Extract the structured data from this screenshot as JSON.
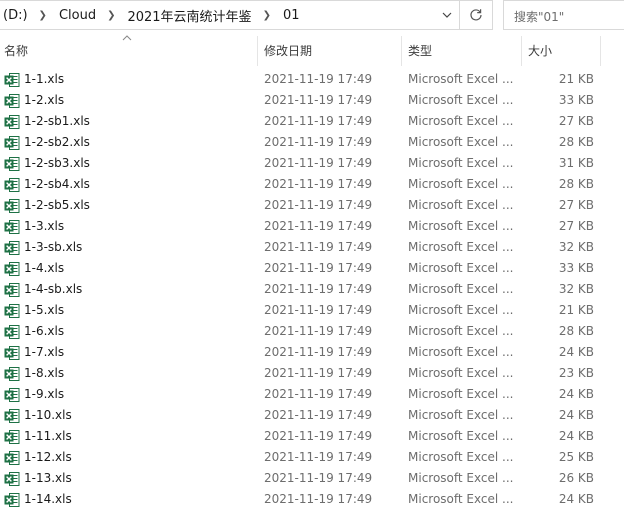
{
  "address_bar": {
    "segments": [
      "(D:)",
      "Cloud",
      "2021年云南统计年鉴",
      "01"
    ]
  },
  "search": {
    "placeholder": "搜索\"01\""
  },
  "columns": {
    "name": "名称",
    "modified": "修改日期",
    "type": "类型",
    "size": "大小"
  },
  "icons": {
    "file": "excel-file-icon",
    "refresh": "refresh-icon",
    "dropdown": "chevron-down-icon",
    "sort": "sort-ascending-icon"
  },
  "colors": {
    "excel_green": "#1e7145"
  },
  "files": [
    {
      "name": "1-1.xls",
      "modified": "2021-11-19 17:49",
      "type": "Microsoft Excel ...",
      "size": "21 KB"
    },
    {
      "name": "1-2.xls",
      "modified": "2021-11-19 17:49",
      "type": "Microsoft Excel ...",
      "size": "33 KB"
    },
    {
      "name": "1-2-sb1.xls",
      "modified": "2021-11-19 17:49",
      "type": "Microsoft Excel ...",
      "size": "27 KB"
    },
    {
      "name": "1-2-sb2.xls",
      "modified": "2021-11-19 17:49",
      "type": "Microsoft Excel ...",
      "size": "28 KB"
    },
    {
      "name": "1-2-sb3.xls",
      "modified": "2021-11-19 17:49",
      "type": "Microsoft Excel ...",
      "size": "31 KB"
    },
    {
      "name": "1-2-sb4.xls",
      "modified": "2021-11-19 17:49",
      "type": "Microsoft Excel ...",
      "size": "28 KB"
    },
    {
      "name": "1-2-sb5.xls",
      "modified": "2021-11-19 17:49",
      "type": "Microsoft Excel ...",
      "size": "27 KB"
    },
    {
      "name": "1-3.xls",
      "modified": "2021-11-19 17:49",
      "type": "Microsoft Excel ...",
      "size": "27 KB"
    },
    {
      "name": "1-3-sb.xls",
      "modified": "2021-11-19 17:49",
      "type": "Microsoft Excel ...",
      "size": "32 KB"
    },
    {
      "name": "1-4.xls",
      "modified": "2021-11-19 17:49",
      "type": "Microsoft Excel ...",
      "size": "33 KB"
    },
    {
      "name": "1-4-sb.xls",
      "modified": "2021-11-19 17:49",
      "type": "Microsoft Excel ...",
      "size": "32 KB"
    },
    {
      "name": "1-5.xls",
      "modified": "2021-11-19 17:49",
      "type": "Microsoft Excel ...",
      "size": "21 KB"
    },
    {
      "name": "1-6.xls",
      "modified": "2021-11-19 17:49",
      "type": "Microsoft Excel ...",
      "size": "28 KB"
    },
    {
      "name": "1-7.xls",
      "modified": "2021-11-19 17:49",
      "type": "Microsoft Excel ...",
      "size": "24 KB"
    },
    {
      "name": "1-8.xls",
      "modified": "2021-11-19 17:49",
      "type": "Microsoft Excel ...",
      "size": "23 KB"
    },
    {
      "name": "1-9.xls",
      "modified": "2021-11-19 17:49",
      "type": "Microsoft Excel ...",
      "size": "24 KB"
    },
    {
      "name": "1-10.xls",
      "modified": "2021-11-19 17:49",
      "type": "Microsoft Excel ...",
      "size": "24 KB"
    },
    {
      "name": "1-11.xls",
      "modified": "2021-11-19 17:49",
      "type": "Microsoft Excel ...",
      "size": "24 KB"
    },
    {
      "name": "1-12.xls",
      "modified": "2021-11-19 17:49",
      "type": "Microsoft Excel ...",
      "size": "25 KB"
    },
    {
      "name": "1-13.xls",
      "modified": "2021-11-19 17:49",
      "type": "Microsoft Excel ...",
      "size": "26 KB"
    },
    {
      "name": "1-14.xls",
      "modified": "2021-11-19 17:49",
      "type": "Microsoft Excel ...",
      "size": "24 KB"
    }
  ]
}
